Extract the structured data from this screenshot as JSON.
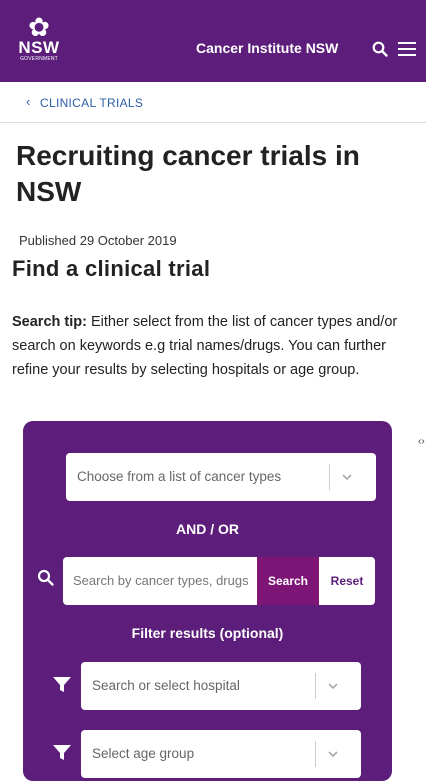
{
  "header": {
    "logo_icon": "waratah-flower",
    "logo_text": "NSW",
    "logo_subtext": "GOVERNMENT",
    "site_title": "Cancer Institute NSW",
    "search_icon": "search-icon",
    "menu_icon": "hamburger-menu-icon"
  },
  "breadcrumb": {
    "label": "CLINICAL TRIALS"
  },
  "page": {
    "title": "Recruiting cancer trials in NSW",
    "published": "Published 29 October 2019",
    "section_title": "Find a clinical trial",
    "tip_label": "Search tip:",
    "tip_text": " Either select from the list of cancer types and/or search on keywords e.g trial names/drugs. You can further refine your results by selecting hospitals or age group."
  },
  "search_panel": {
    "cancer_type_placeholder": "Choose from a list of cancer types",
    "and_or": "AND / OR",
    "keyword_placeholder": "Search by cancer types, drugs",
    "search_button": "Search",
    "reset_button": "Reset",
    "filter_title": "Filter results (optional)",
    "hospital_placeholder": "Search or select hospital",
    "age_placeholder": "Select age group"
  },
  "colors": {
    "brand_purple": "#5c1e7a",
    "search_button": "#7d1577",
    "link_blue": "#2b5ea8"
  }
}
